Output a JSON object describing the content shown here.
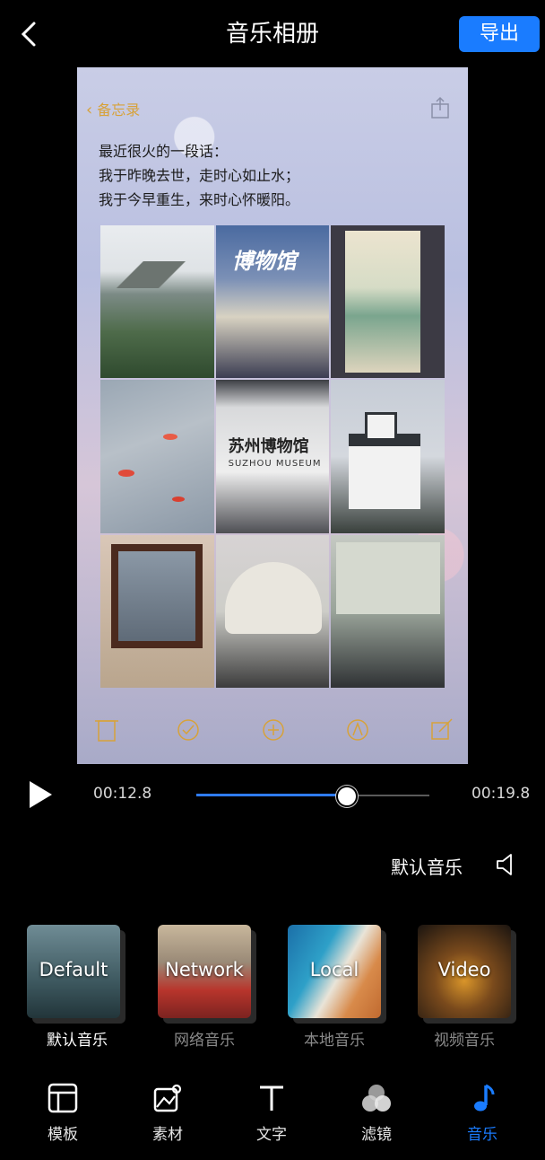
{
  "header": {
    "title": "音乐相册",
    "export_label": "导出"
  },
  "preview": {
    "memo_back_label": "备忘录",
    "memo_lines": [
      "最近很火的一段话：",
      "我于昨晚去世，走时心如止水；",
      "我于今早重生，来时心怀暖阳。"
    ],
    "photo_signs": [
      "博物馆",
      "苏州博物馆",
      "SUZHOU MUSEUM"
    ],
    "toolbar_icons": [
      "trash-icon",
      "check-circle-icon",
      "plus-circle-icon",
      "text-a-icon",
      "compose-icon"
    ]
  },
  "playback": {
    "current_time": "00:12.8",
    "total_time": "00:19.8",
    "progress_fraction": 0.646
  },
  "music": {
    "current_label": "默认音乐",
    "cards": [
      {
        "title": "Default",
        "caption": "默认音乐",
        "selected": true
      },
      {
        "title": "Network",
        "caption": "网络音乐",
        "selected": false
      },
      {
        "title": "Local",
        "caption": "本地音乐",
        "selected": false
      },
      {
        "title": "Video",
        "caption": "视频音乐",
        "selected": false
      }
    ]
  },
  "nav": {
    "items": [
      {
        "label": "模板",
        "icon": "template-icon",
        "active": false
      },
      {
        "label": "素材",
        "icon": "material-icon",
        "active": false
      },
      {
        "label": "文字",
        "icon": "text-icon",
        "active": false
      },
      {
        "label": "滤镜",
        "icon": "filter-icon",
        "active": false
      },
      {
        "label": "音乐",
        "icon": "music-note-icon",
        "active": true
      }
    ]
  },
  "colors": {
    "accent": "#1a7cff",
    "memo_accent": "#d7a23a",
    "inactive_caption": "#8a8a8a"
  }
}
